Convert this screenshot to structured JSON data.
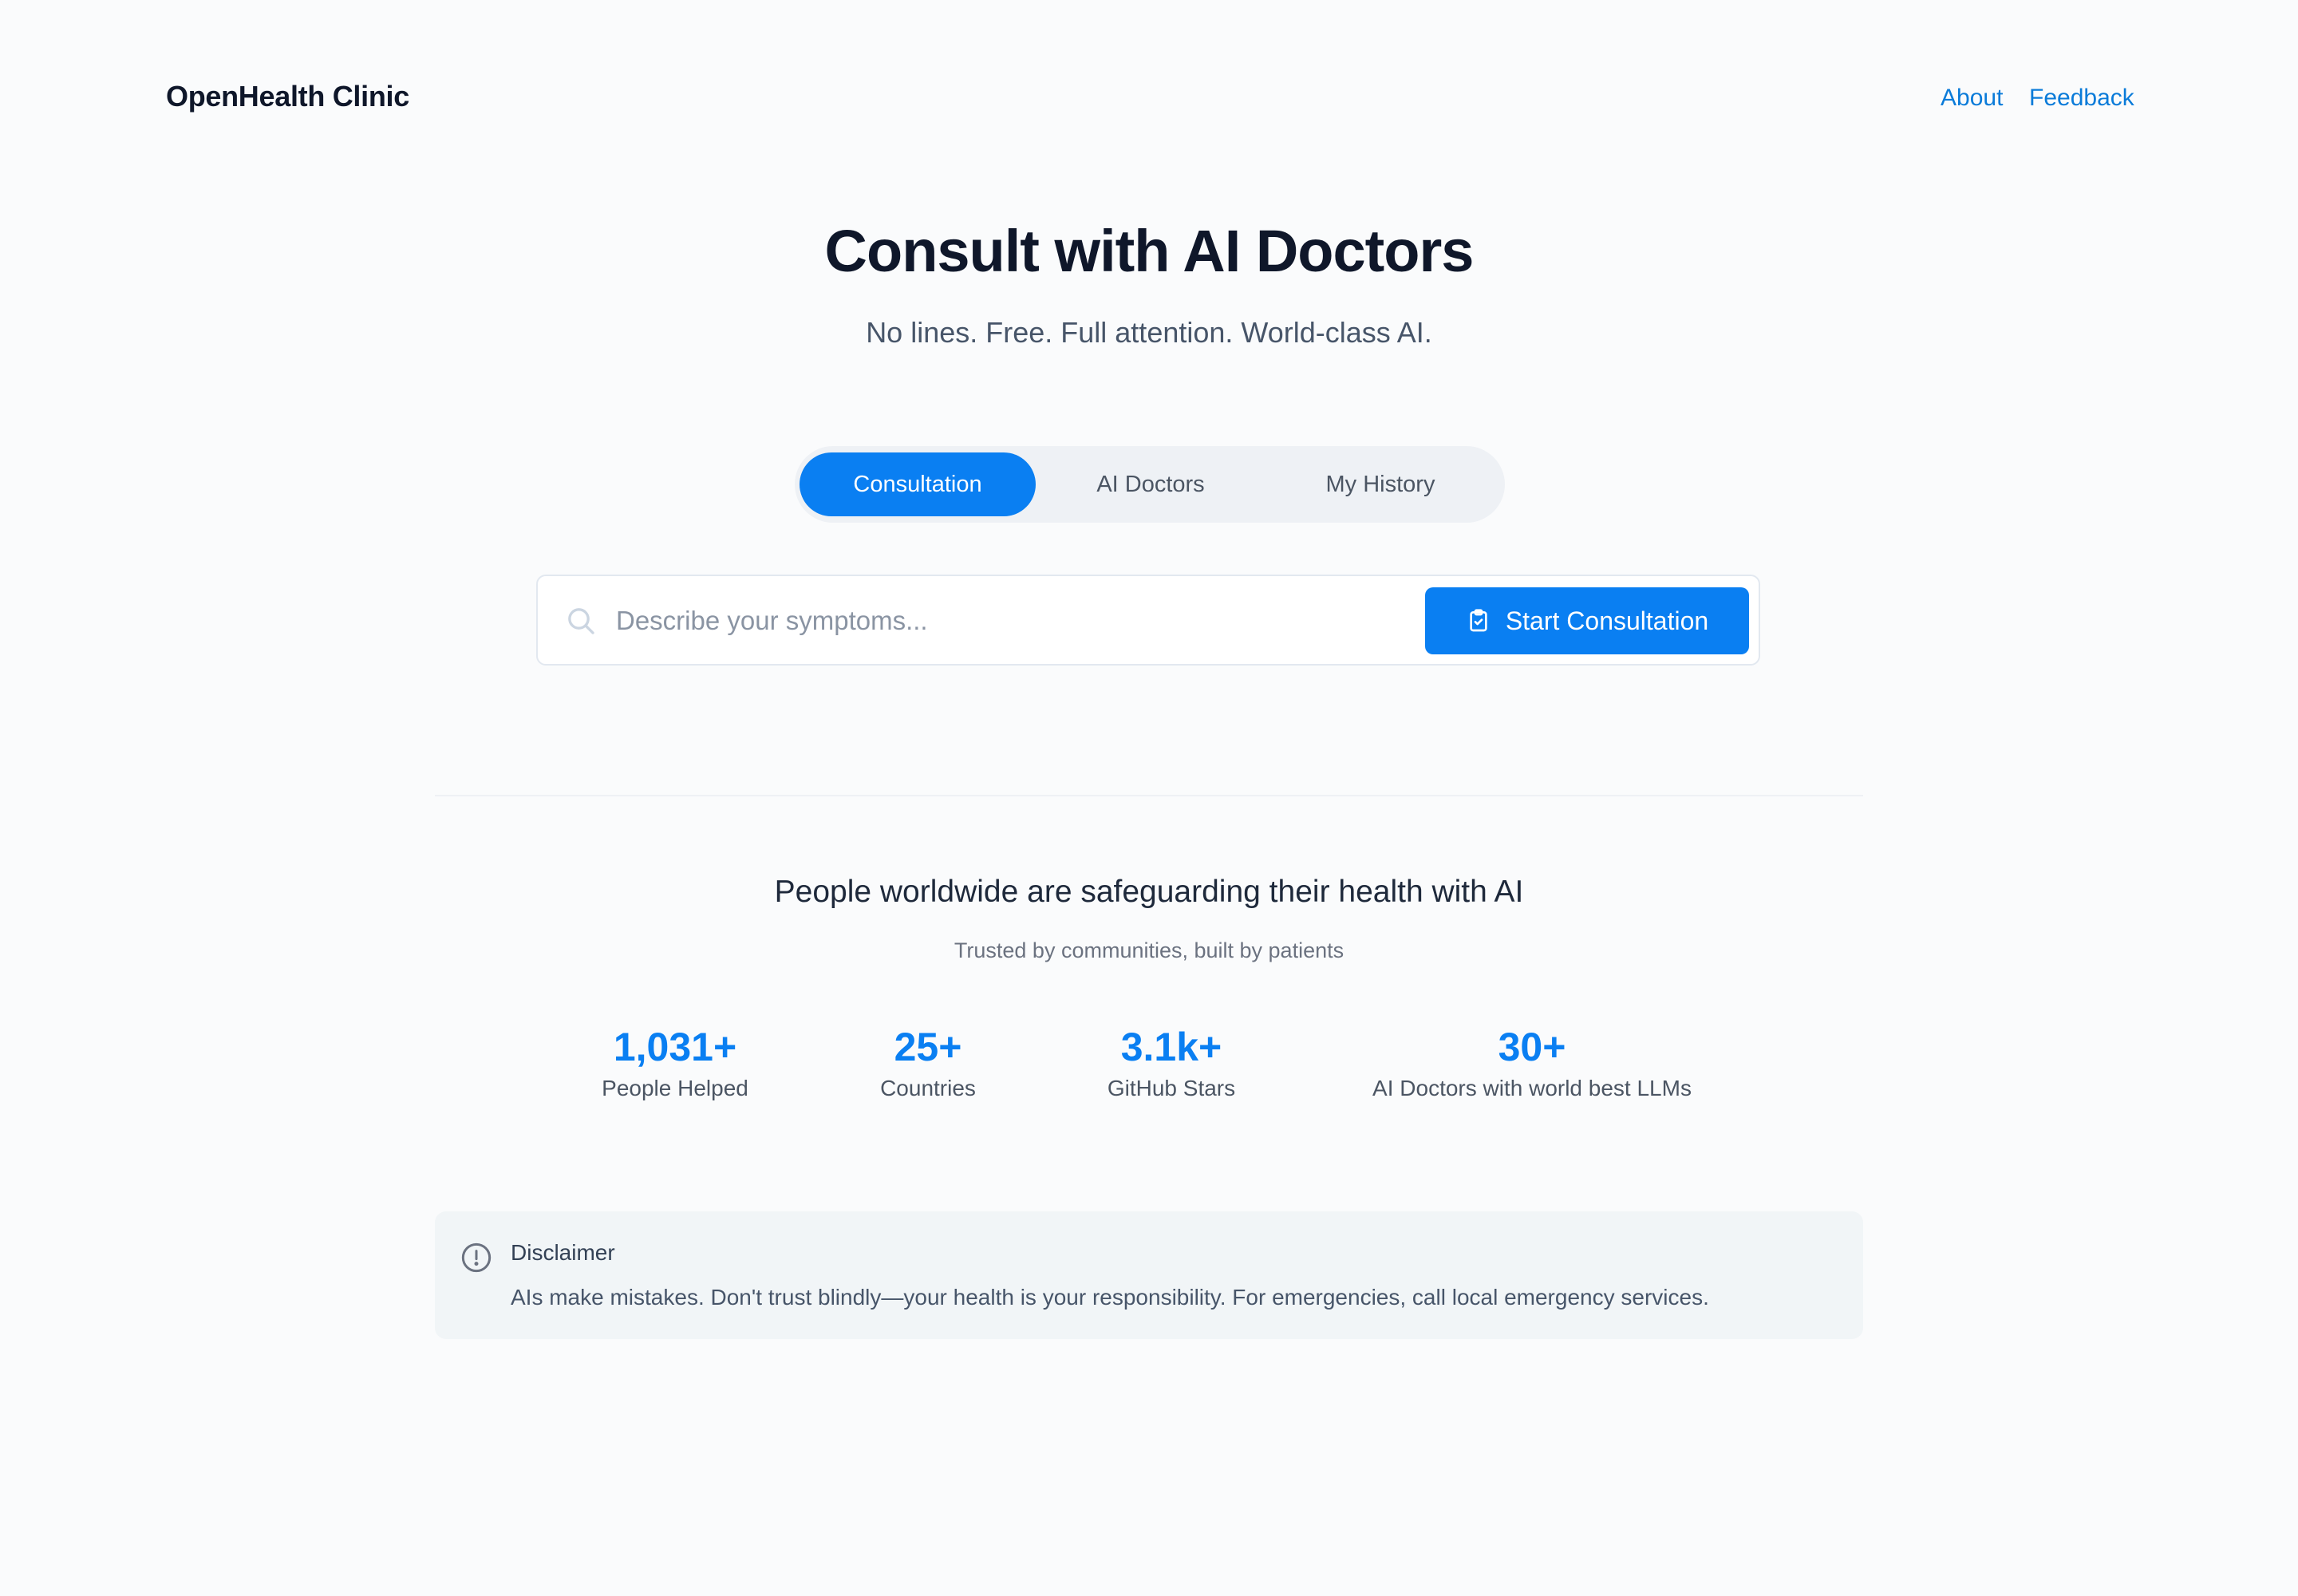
{
  "header": {
    "brand": "OpenHealth Clinic",
    "nav": [
      "About",
      "Feedback"
    ]
  },
  "hero": {
    "title": "Consult with AI Doctors",
    "subtitle": "No lines. Free. Full attention. World-class AI."
  },
  "tabs": [
    {
      "label": "Consultation",
      "active": true
    },
    {
      "label": "AI Doctors",
      "active": false
    },
    {
      "label": "My History",
      "active": false
    }
  ],
  "search": {
    "placeholder": "Describe your symptoms...",
    "value": "",
    "icon": "search-icon",
    "button_label": "Start Consultation",
    "button_icon": "clipboard-check-icon"
  },
  "social_proof": {
    "title": "People worldwide are safeguarding their health with AI",
    "subtitle": "Trusted by communities, built by patients",
    "stats": [
      {
        "value": "1,031+",
        "label": "People Helped"
      },
      {
        "value": "25+",
        "label": "Countries"
      },
      {
        "value": "3.1k+",
        "label": "GitHub Stars"
      },
      {
        "value": "30+",
        "label": "AI Doctors with world best LLMs"
      }
    ]
  },
  "disclaimer": {
    "icon": "alert-circle-icon",
    "title": "Disclaimer",
    "text": "AIs make mistakes. Don't trust blindly—your health is your responsibility. For emergencies, call local emergency services."
  },
  "colors": {
    "accent": "#0a7ff2",
    "link": "#0a7bd9",
    "background": "#fafbfc"
  }
}
